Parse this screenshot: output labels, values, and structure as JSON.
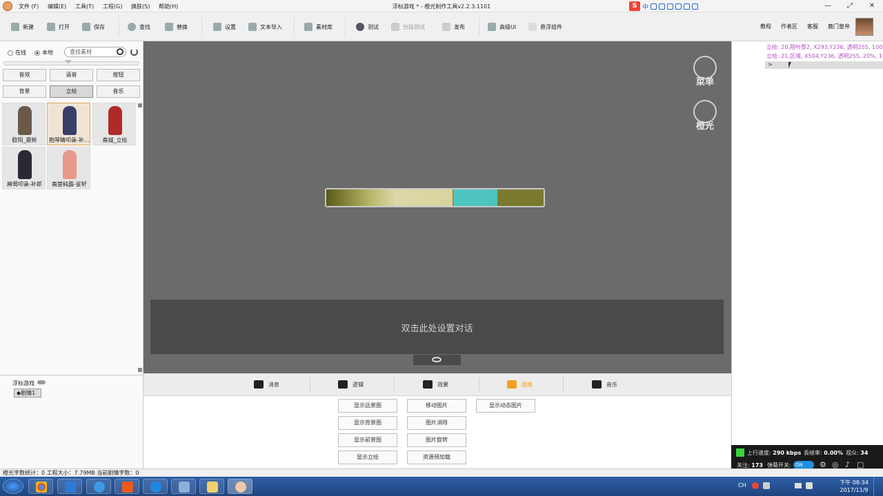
{
  "window": {
    "title": "浮标游戏 * - 橙光制作工具v2.2.3.1101",
    "menu": [
      "文件 (F)",
      "编辑(E)",
      "工具(T)",
      "工程(G)",
      "换肤(S)",
      "帮助(H)"
    ]
  },
  "toolbar": {
    "items": [
      {
        "label": "新建",
        "icon": "new-icon"
      },
      {
        "label": "打开",
        "icon": "open-icon"
      },
      {
        "label": "保存",
        "icon": "save-icon"
      },
      {
        "label": "查找",
        "icon": "find-icon"
      },
      {
        "label": "替换",
        "icon": "replace-icon"
      },
      {
        "label": "设置",
        "icon": "settings-icon"
      },
      {
        "label": "文本导入",
        "icon": "text-import-icon"
      },
      {
        "label": "素材库",
        "icon": "library-icon"
      },
      {
        "label": "测试",
        "icon": "play-icon"
      },
      {
        "label": "分段测试",
        "icon": "segment-test-icon"
      },
      {
        "label": "发布",
        "icon": "publish-icon"
      },
      {
        "label": "高级UI",
        "icon": "advanced-ui-icon"
      },
      {
        "label": "悬浮组件",
        "icon": "floating-widget-icon"
      }
    ],
    "right_links": [
      "教程",
      "作者区",
      "客服",
      "鹿门皇帝"
    ]
  },
  "assets_panel": {
    "source_online": "在线",
    "source_local": "本地",
    "search_placeholder": "查找素材",
    "categories_row1": [
      "音效",
      "语音",
      "按钮"
    ],
    "categories_row2": [
      "背景",
      "立绘",
      "音乐"
    ],
    "active_category": "立绘",
    "items": [
      {
        "label": "欧阳_震新",
        "color": "#6b5a4a"
      },
      {
        "label": "抱琴睛叩彘-补…",
        "color": "#3a3f6a"
      },
      {
        "label": "斋城_立绘",
        "color": "#b02a2a"
      },
      {
        "label": "麻莺叩彘-补郎",
        "color": "#2a2a35"
      },
      {
        "label": "斋楚砘露-娑轩",
        "color": "#e89a8a"
      }
    ]
  },
  "project_panel": {
    "root": "浮标游戏",
    "scene": "剧情1"
  },
  "stage": {
    "menu_label": "菜单",
    "brand_label": "橙光",
    "progress": 0.49,
    "dialog_hint": "双击此处设置对话"
  },
  "command_tabs": [
    {
      "label": "消息",
      "icon": "message-icon"
    },
    {
      "label": "逻辑",
      "icon": "logic-icon"
    },
    {
      "label": "效果",
      "icon": "effect-icon"
    },
    {
      "label": "图像",
      "icon": "image-icon"
    },
    {
      "label": "音乐",
      "icon": "music-icon"
    }
  ],
  "active_command_tab": "图像",
  "image_commands": {
    "col1": [
      "显示远景图",
      "显示背景图",
      "显示前景图",
      "显示立绘"
    ],
    "col2": [
      "移动图片",
      "图片消除",
      "图片旋转",
      "资源预加载"
    ],
    "col3": [
      "显示动态图片"
    ]
  },
  "log": {
    "lines": [
      "立绘: 20,陌叶祭2, X293,Y236, 透明255, 100%,",
      "立绘: 21,区域, X504,Y236, 透明255, 20%, 100%"
    ],
    "row_arrow": ">"
  },
  "stream": {
    "upload_label": "上行速度:",
    "upload_value": "290 kbps",
    "loss_label": "丢帧率:",
    "loss_value": "0.00%",
    "viewers_label": "观众:",
    "viewers_value": "34",
    "follow_label": "关注:",
    "follow_value": "173",
    "danmaku_label": "弹幕开关:",
    "danmaku_toggle": "ON"
  },
  "statusbar": {
    "text": "橙光字数统计：0  工程大小：7.79MB  当前剧情字数：0"
  },
  "taskbar": {
    "tray_ime": "CH",
    "time": "下午 08:34",
    "date": "2017/11/9"
  },
  "colors": {
    "stage_bg": "#6b6b6b",
    "dialog_bg": "#4a4a4a",
    "accent_orange": "#f5a020",
    "log_text": "#b04ec0",
    "progress_teal": "#4ec4be"
  }
}
